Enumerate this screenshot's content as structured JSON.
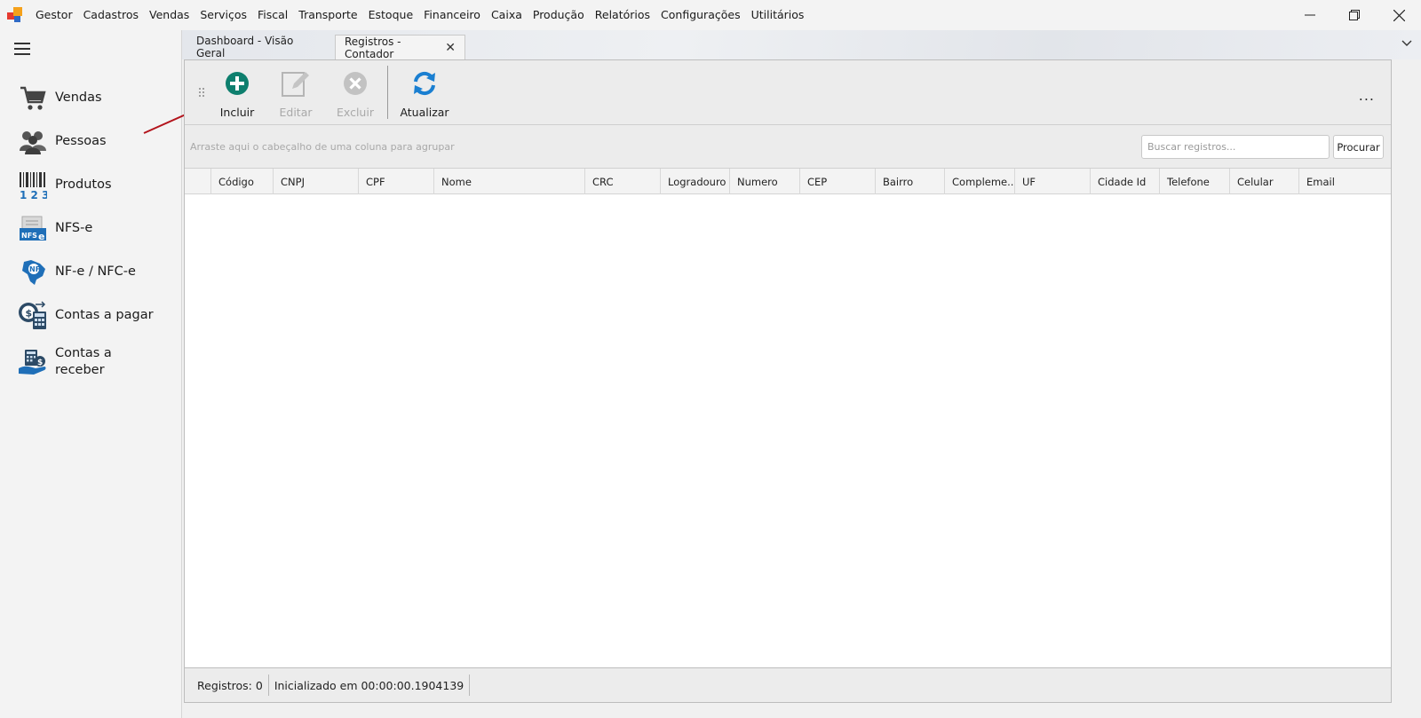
{
  "menubar": {
    "items": [
      "Gestor",
      "Cadastros",
      "Vendas",
      "Serviços",
      "Fiscal",
      "Transporte",
      "Estoque",
      "Financeiro",
      "Caixa",
      "Produção",
      "Relatórios",
      "Configurações",
      "Utilitários"
    ],
    "window_controls": [
      "minimize-icon",
      "restore-icon",
      "close-icon"
    ]
  },
  "sidebar": {
    "items": [
      {
        "label": "Vendas",
        "icon": "shopping-cart-icon"
      },
      {
        "label": "Pessoas",
        "icon": "people-icon"
      },
      {
        "label": "Produtos",
        "icon": "barcode-icon"
      },
      {
        "label": "NFS-e",
        "icon": "nfse-icon"
      },
      {
        "label": "NF-e / NFC-e",
        "icon": "nfe-icon"
      },
      {
        "label": "Contas a pagar",
        "icon": "accounts-payable-icon"
      },
      {
        "label": "Contas a receber",
        "icon": "accounts-receivable-icon"
      }
    ]
  },
  "tabs": [
    {
      "label": "Dashboard - Visão Geral",
      "active": false
    },
    {
      "label": "Registros - Contador",
      "active": true
    }
  ],
  "toolbar": {
    "incluir": "Incluir",
    "editar": "Editar",
    "excluir": "Excluir",
    "atualizar": "Atualizar",
    "more": "..."
  },
  "grouping": {
    "hint": "Arraste aqui o cabeçalho de uma coluna para agrupar",
    "search_placeholder": "Buscar registros...",
    "search_button": "Procurar"
  },
  "grid": {
    "columns": [
      "",
      "Código",
      "CNPJ",
      "CPF",
      "Nome",
      "CRC",
      "Logradouro",
      "Numero",
      "CEP",
      "Bairro",
      "Compleme...",
      "UF",
      "Cidade Id",
      "Telefone",
      "Celular",
      "Email"
    ],
    "rows": []
  },
  "status": {
    "records": "Registros: 0",
    "init": "Inicializado em 00:00:00.1904139"
  },
  "colors": {
    "accent_green": "#0e7f6e",
    "refresh_blue": "#1a7fd1",
    "annotation_arrow": "#b3141c"
  }
}
